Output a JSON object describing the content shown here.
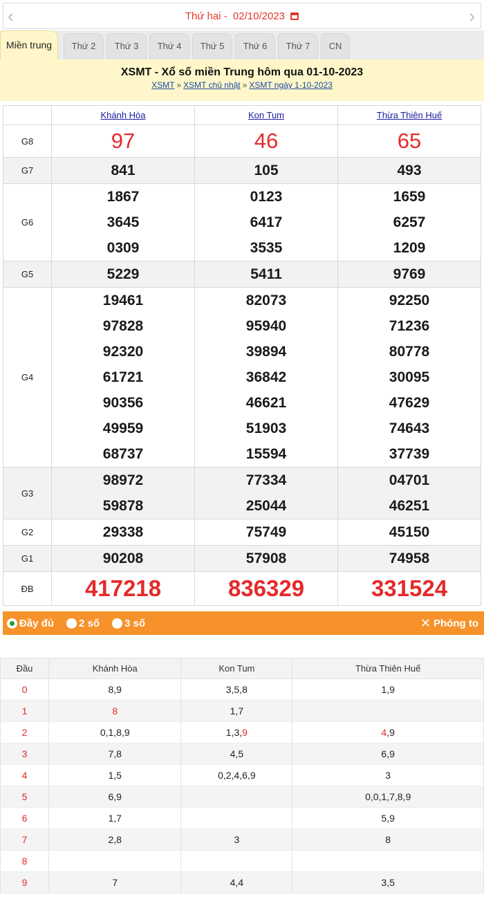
{
  "date_bar": {
    "prev": "‹",
    "next": "›",
    "day": "Thứ hai -",
    "date": "02/10/2023"
  },
  "tabs": [
    "Miền trung",
    "Thứ 2",
    "Thứ 3",
    "Thứ 4",
    "Thứ 5",
    "Thứ 6",
    "Thứ 7",
    "CN"
  ],
  "header": {
    "title": "XSMT - Xổ số miền Trung hôm qua 01-10-2023",
    "crumbs": [
      "XSMT",
      "XSMT chủ nhật",
      "XSMT ngày 1-10-2023"
    ],
    "sep": "»"
  },
  "provinces": [
    "Khánh Hòa",
    "Kon Tum",
    "Thừa Thiên Huế"
  ],
  "prizes": [
    {
      "label": "G8",
      "values": [
        [
          "97"
        ],
        [
          "46"
        ],
        [
          "65"
        ]
      ]
    },
    {
      "label": "G7",
      "values": [
        [
          "841"
        ],
        [
          "105"
        ],
        [
          "493"
        ]
      ]
    },
    {
      "label": "G6",
      "values": [
        [
          "1867",
          "3645",
          "0309"
        ],
        [
          "0123",
          "6417",
          "3535"
        ],
        [
          "1659",
          "6257",
          "1209"
        ]
      ]
    },
    {
      "label": "G5",
      "values": [
        [
          "5229"
        ],
        [
          "5411"
        ],
        [
          "9769"
        ]
      ]
    },
    {
      "label": "G4",
      "values": [
        [
          "19461",
          "97828",
          "92320",
          "61721",
          "90356",
          "49959",
          "68737"
        ],
        [
          "82073",
          "95940",
          "39894",
          "36842",
          "46621",
          "51903",
          "15594"
        ],
        [
          "92250",
          "71236",
          "80778",
          "30095",
          "47629",
          "74643",
          "37739"
        ]
      ]
    },
    {
      "label": "G3",
      "values": [
        [
          "98972",
          "59878"
        ],
        [
          "77334",
          "25044"
        ],
        [
          "04701",
          "46251"
        ]
      ]
    },
    {
      "label": "G2",
      "values": [
        [
          "29338"
        ],
        [
          "75749"
        ],
        [
          "45150"
        ]
      ]
    },
    {
      "label": "G1",
      "values": [
        [
          "90208"
        ],
        [
          "57908"
        ],
        [
          "74958"
        ]
      ]
    },
    {
      "label": "ĐB",
      "values": [
        [
          "417218"
        ],
        [
          "836329"
        ],
        [
          "331524"
        ]
      ]
    }
  ],
  "options": {
    "full": "Đầy đủ",
    "two": "2 số",
    "three": "3 số",
    "zoom": "Phóng to"
  },
  "loto": {
    "head_label": "Đầu",
    "rows": [
      {
        "head": "0",
        "cells": [
          [
            [
              "8,9",
              false
            ]
          ],
          [
            [
              "3,5,8",
              false
            ]
          ],
          [
            [
              "1,9",
              false
            ]
          ]
        ]
      },
      {
        "head": "1",
        "cells": [
          [
            [
              "8",
              true
            ]
          ],
          [
            [
              "1,7",
              false
            ]
          ],
          []
        ]
      },
      {
        "head": "2",
        "cells": [
          [
            [
              "0,1,8,9",
              false
            ]
          ],
          [
            [
              "1,3,",
              false
            ],
            [
              "9",
              true
            ]
          ],
          [
            [
              "4",
              true
            ],
            [
              ",9",
              false
            ]
          ]
        ]
      },
      {
        "head": "3",
        "cells": [
          [
            [
              "7,8",
              false
            ]
          ],
          [
            [
              "4,5",
              false
            ]
          ],
          [
            [
              "6,9",
              false
            ]
          ]
        ]
      },
      {
        "head": "4",
        "cells": [
          [
            [
              "1,5",
              false
            ]
          ],
          [
            [
              "0,2,4,6,9",
              false
            ]
          ],
          [
            [
              "3",
              false
            ]
          ]
        ]
      },
      {
        "head": "5",
        "cells": [
          [
            [
              "6,9",
              false
            ]
          ],
          [],
          [
            [
              "0,0,1,7,8,9",
              false
            ]
          ]
        ]
      },
      {
        "head": "6",
        "cells": [
          [
            [
              "1,7",
              false
            ]
          ],
          [],
          [
            [
              "5,9",
              false
            ]
          ]
        ]
      },
      {
        "head": "7",
        "cells": [
          [
            [
              "2,8",
              false
            ]
          ],
          [
            [
              "3",
              false
            ]
          ],
          [
            [
              "8",
              false
            ]
          ]
        ]
      },
      {
        "head": "8",
        "cells": [
          [],
          [],
          []
        ]
      },
      {
        "head": "9",
        "cells": [
          [
            [
              "7",
              false
            ]
          ],
          [
            [
              "4,4",
              false
            ]
          ],
          [
            [
              "3,5",
              false
            ]
          ]
        ]
      }
    ]
  },
  "colors": {
    "accent_red": "#e52a2a",
    "header_bg": "#fff7c9",
    "orange_bar": "#f7922a",
    "link_blue": "#1a1aa0"
  }
}
